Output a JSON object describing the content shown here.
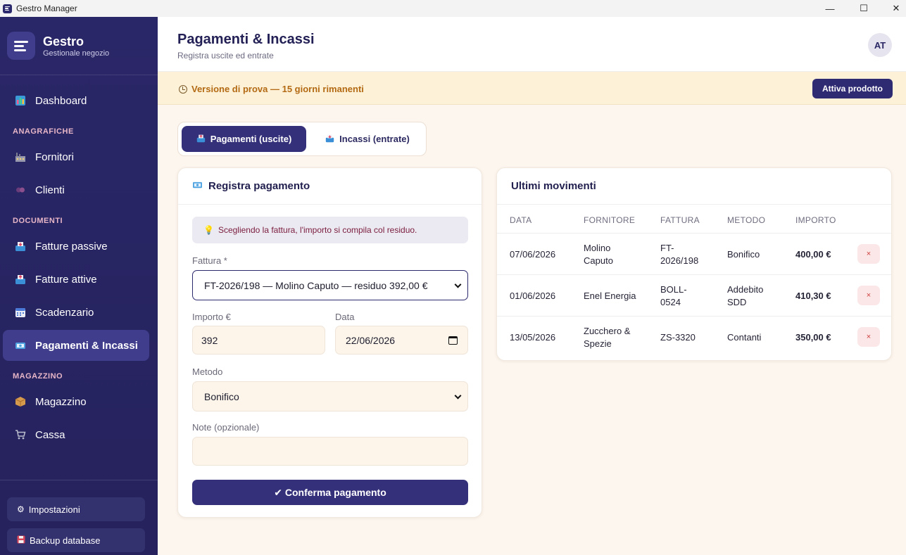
{
  "window": {
    "title": "Gestro Manager",
    "minimize": "—",
    "maximize": "☐",
    "close": "✕"
  },
  "brand": {
    "name": "Gestro",
    "subtitle": "Gestionale negozio"
  },
  "sidebar": {
    "dashboard": "Dashboard",
    "section_anagrafiche": "ANAGRAFICHE",
    "fornitori": "Fornitori",
    "clienti": "Clienti",
    "section_documenti": "DOCUMENTI",
    "fatture_passive": "Fatture passive",
    "fatture_attive": "Fatture attive",
    "scadenzario": "Scadenzario",
    "pagamenti": "Pagamenti & Incassi",
    "section_magazzino": "MAGAZZINO",
    "magazzino": "Magazzino",
    "cassa": "Cassa",
    "impostazioni": "Impostazioni",
    "backup": "Backup database"
  },
  "header": {
    "title": "Pagamenti & Incassi",
    "subtitle": "Registra uscite ed entrate",
    "avatar": "AT"
  },
  "banner": {
    "text": "Versione di prova — 15 giorni rimanenti",
    "button": "Attiva prodotto"
  },
  "tabs": {
    "pagamenti": "Pagamenti (uscite)",
    "incassi": "Incassi (entrate)"
  },
  "form": {
    "title": "Registra pagamento",
    "hint": "Scegliendo la fattura, l'importo si compila col residuo.",
    "fattura_label": "Fattura *",
    "fattura_value": "FT-2026/198 — Molino Caputo — residuo 392,00 €",
    "importo_label": "Importo €",
    "importo_value": "392",
    "data_label": "Data",
    "data_value": "22/06/2026",
    "metodo_label": "Metodo",
    "metodo_value": "Bonifico",
    "note_label": "Note (opzionale)",
    "note_value": "",
    "confirm": "✔ Conferma pagamento"
  },
  "movements": {
    "title": "Ultimi movimenti",
    "headers": {
      "data": "DATA",
      "fornitore": "FORNITORE",
      "fattura": "FATTURA",
      "metodo": "METODO",
      "importo": "IMPORTO"
    },
    "rows": [
      {
        "data": "07/06/2026",
        "fornitore_1": "Molino",
        "fornitore_2": "Caputo",
        "fattura_1": "FT-",
        "fattura_2": "2026/198",
        "metodo_1": "Bonifico",
        "metodo_2": "",
        "importo": "400,00 €"
      },
      {
        "data": "01/06/2026",
        "fornitore_1": "Enel Energia",
        "fornitore_2": "",
        "fattura_1": "BOLL-",
        "fattura_2": "0524",
        "metodo_1": "Addebito",
        "metodo_2": "SDD",
        "importo": "410,30 €"
      },
      {
        "data": "13/05/2026",
        "fornitore_1": "Zucchero &",
        "fornitore_2": "Spezie",
        "fattura_1": "ZS-3320",
        "fattura_2": "",
        "metodo_1": "Contanti",
        "metodo_2": "",
        "importo": "350,00 €"
      }
    ],
    "delete_symbol": "×"
  }
}
